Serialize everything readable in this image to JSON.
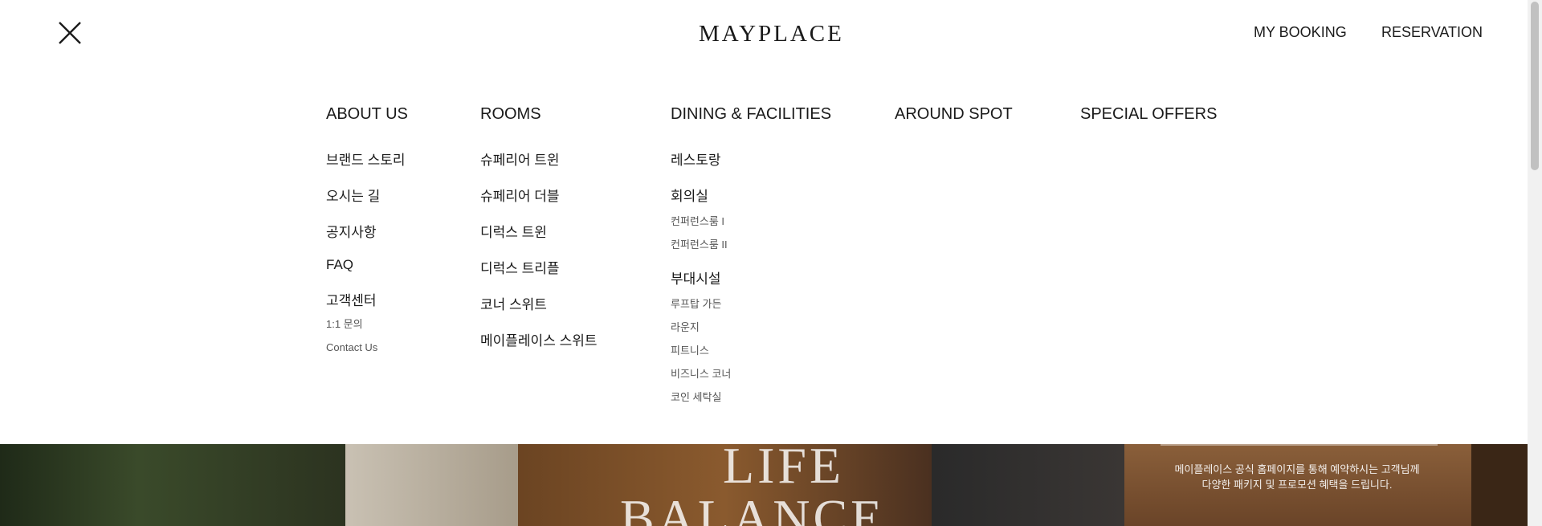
{
  "header": {
    "logo": "MAYPLACE",
    "my_booking": "MY BOOKING",
    "reservation": "RESERVATION"
  },
  "menu": {
    "about": {
      "title": "ABOUT US",
      "items": [
        "브랜드 스토리",
        "오시는 길",
        "공지사항",
        "FAQ",
        "고객센터"
      ],
      "sub_items": [
        "1:1 문의",
        "Contact Us"
      ]
    },
    "rooms": {
      "title": "ROOMS",
      "items": [
        "슈페리어 트윈",
        "슈페리어 더블",
        "디럭스 트윈",
        "디럭스 트리플",
        "코너 스위트",
        "메이플레이스 스위트"
      ]
    },
    "dining": {
      "title": "DINING & FACILITIES",
      "restaurant": "레스토랑",
      "meeting": "회의실",
      "meeting_subs": [
        "컨퍼런스룸 I",
        "컨퍼런스룸 II"
      ],
      "amenities": "부대시설",
      "amenity_subs": [
        "루프탑 가든",
        "라운지",
        "피트니스",
        "비즈니스 코너",
        "코인 세탁실"
      ]
    },
    "around": {
      "title": "AROUND SPOT"
    },
    "special": {
      "title": "SPECIAL OFFERS"
    }
  },
  "banner": {
    "word1": "LIFE",
    "word2": "BALANCE",
    "promo_line1": "메이플레이스 공식 홈페이지를 통해 예약하시는 고객님께",
    "promo_line2": "다양한 패키지 및 프로모션 혜택을 드립니다."
  }
}
